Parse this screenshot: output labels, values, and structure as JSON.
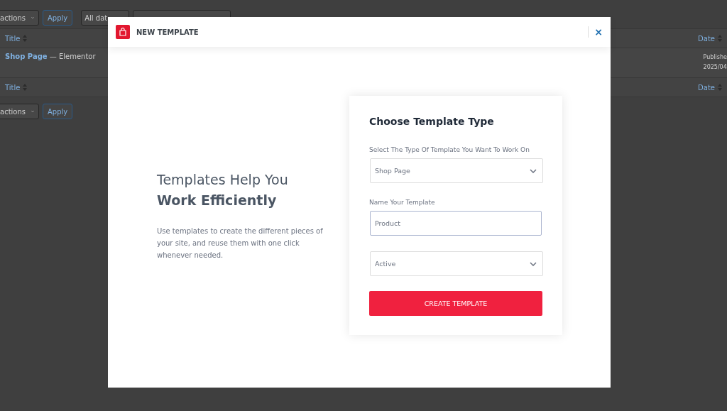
{
  "background_page": {
    "top_toolbar": {
      "bulk_actions": "actions",
      "apply": "Apply",
      "date_filter": "All dat"
    },
    "table": {
      "columns": [
        {
          "label": "Title"
        },
        {
          "label": "Date"
        }
      ],
      "footer_columns": [
        {
          "label": "Title"
        },
        {
          "label": "Date"
        }
      ],
      "rows": [
        {
          "title": "Shop Page",
          "suffix": "— Elementor",
          "status": "Publishe",
          "date": "2025/04"
        }
      ]
    },
    "bottom_toolbar": {
      "bulk_actions": "actions",
      "apply": "Apply"
    }
  },
  "modal": {
    "title": "NEW TEMPLATE",
    "close": "×",
    "intro": {
      "heading_line_1": "Templates Help You",
      "heading_line_2": "Work Efficiently",
      "text": "Use templates to create the different pieces of your site, and reuse them with one click whenever needed."
    },
    "form": {
      "title": "Choose Template Type",
      "fields": [
        {
          "kind": "select",
          "label": "Select The Type Of Template You Want To Work On",
          "value": "Shop Page"
        },
        {
          "kind": "text",
          "label": "Name Your Template",
          "value": "Product"
        },
        {
          "kind": "select",
          "value": "Active"
        }
      ],
      "submit": "CREATE TEMPLATE"
    }
  }
}
